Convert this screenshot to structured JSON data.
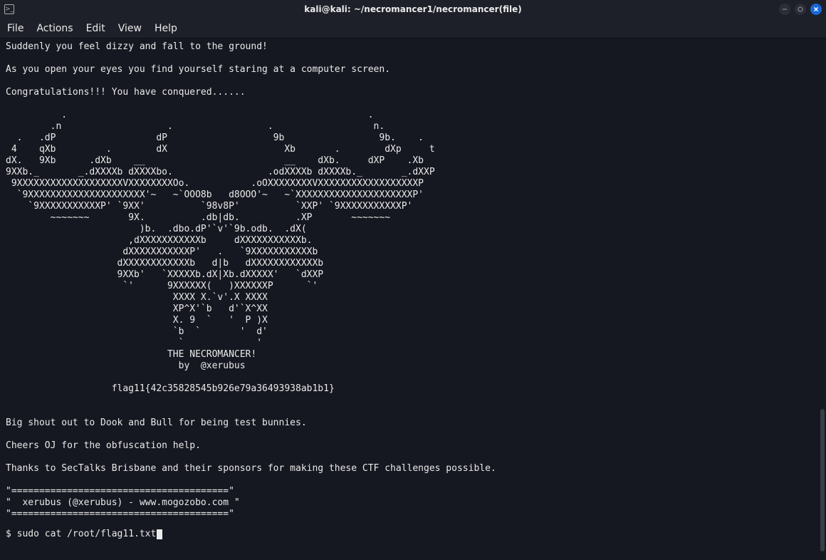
{
  "window": {
    "title": "kali@kali: ~/necromancer1/necromancer(file)"
  },
  "menubar": {
    "items": [
      "File",
      "Actions",
      "Edit",
      "View",
      "Help"
    ]
  },
  "terminal": {
    "output": "Suddenly you feel dizzy and fall to the ground!\n\nAs you open your eyes you find yourself staring at a computer screen.\n\nCongratulations!!! You have conquered......\n\n          .                                                      .\n        .n                   .                 .                  n.\n  .   .dP                  dP                   9b                 9b.    .\n 4    qXb         .        dX                     Xb       .        dXp     t\ndX.   9Xb      .dXb    __                         __    dXb.     dXP    .Xb\n9XXb._       _.dXXXXb dXXXXbo.                 .odXXXXb dXXXXb._       _.dXXP\n 9XXXXXXXXXXXXXXXXXXXVXXXXXXXXOo.           .oOXXXXXXXXVXXXXXXXXXXXXXXXXXXP\n  `9XXXXXXXXXXXXXXXXXXXXX'~   ~`OOO8b   d8OOO'~   ~`XXXXXXXXXXXXXXXXXXXXXP'\n    `9XXXXXXXXXXXP' `9XX'          `98v8P'          `XXP' `9XXXXXXXXXXXP'\n        ~~~~~~~       9X.          .db|db.          .XP       ~~~~~~~\n                        )b.  .dbo.dP'`v'`9b.odb.  .dX(\n                      ,dXXXXXXXXXXXb     dXXXXXXXXXXXb.\n                     dXXXXXXXXXXXP'   .   `9XXXXXXXXXXXb\n                    dXXXXXXXXXXXXb   d|b   dXXXXXXXXXXXXb\n                    9XXb'   `XXXXXb.dX|Xb.dXXXXX'   `dXXP\n                     `'      9XXXXXX(   )XXXXXXP      `'\n                              XXXX X.`v'.X XXXX\n                              XP^X'`b   d'`X^XX\n                              X. 9  `   '  P )X\n                              `b  `       '  d'\n                               `             '\n                             THE NECROMANCER!\n                               by  @xerubus\n\n                   flag11{42c35828545b926e79a36493938ab1b1}\n\n\nBig shout out to Dook and Bull for being test bunnies.\n\nCheers OJ for the obfuscation help.\n\nThanks to SecTalks Brisbane and their sponsors for making these CTF challenges possible.\n\n\"=======================================\"\n\"  xerubus (@xerubus) - www.mogozobo.com \"\n\"=======================================\"\n",
    "prompt": "$ ",
    "command": "sudo cat /root/flag11.txt"
  }
}
